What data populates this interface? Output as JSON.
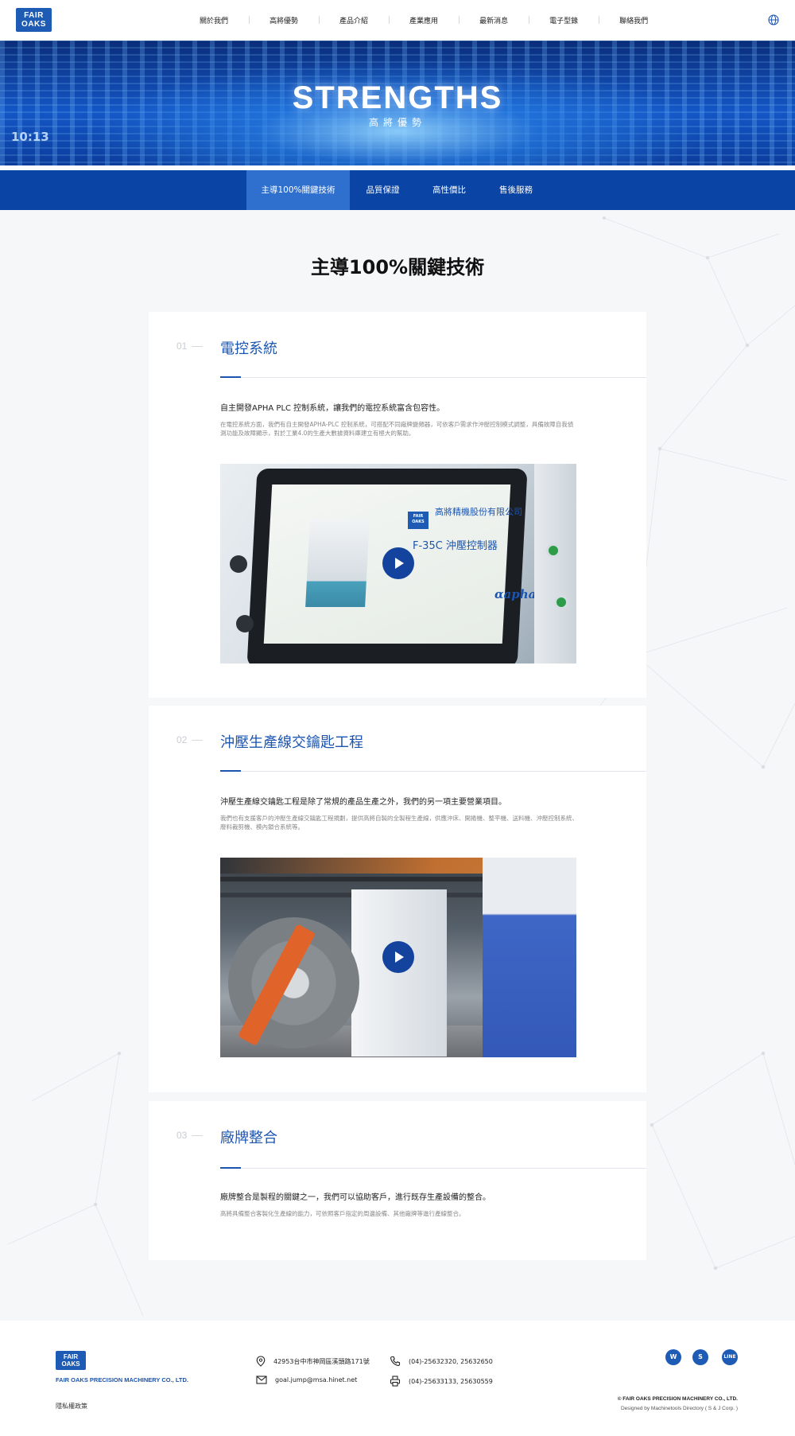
{
  "header": {
    "logo_line1": "FAIR",
    "logo_line2": "OAKS",
    "nav": [
      "關於我們",
      "高將優勢",
      "產品介紹",
      "產業應用",
      "最新消息",
      "電子型錄",
      "聯絡我們"
    ],
    "language_icon": "globe-icon"
  },
  "banner": {
    "title": "STRENGTHS",
    "subtitle": "高將優勢",
    "mark": "10:13"
  },
  "subnav": {
    "items": [
      "主導100%關鍵技術",
      "品質保證",
      "高性價比",
      "售後服務"
    ],
    "active_index": 0
  },
  "main": {
    "section_title": "主導100%關鍵技術",
    "cards": [
      {
        "number": "01",
        "title": "電控系統",
        "lead": "自主開發APHA PLC 控制系統，讓我們的電控系統富含包容性。",
        "description": "在電控系統方面，我們有自主開發APHA-PLC 控制系統，可搭配不同廠牌變頻器，可依客戶需求作沖壓控制模式調整，具備故障自我偵測功能及故障顯示，對於工業4.0的生產大數據資料庫建立有極大的幫助。",
        "video": {
          "screen_company": "高將精機股份有限公司",
          "screen_product": "F-35C 沖壓控制器",
          "screen_brand": "αapha",
          "play_icon": "play-icon"
        }
      },
      {
        "number": "02",
        "title": "沖壓生產線交鑰匙工程",
        "lead": "沖壓生產線交鑰匙工程是除了常規的產品生產之外，我們的另一項主要營業項目。",
        "description": "我們也有支援客戶的沖壓生產線交鑰匙工程規劃，提供高將自製的全製程生產線，供應沖床、開捲機、整平機、送料機、沖壓控制系統、廢料裁剪機、模內鎖合系統等。",
        "video": {
          "play_icon": "play-icon"
        }
      },
      {
        "number": "03",
        "title": "廠牌整合",
        "lead": "廠牌整合是製程的關鍵之一，我們可以協助客戶，進行既存生產設備的整合。",
        "description": "高將具備整合客製化生產線的能力，可依照客戶指定的周邊設備、其他廠牌等進行產線整合。"
      }
    ]
  },
  "footer": {
    "logo_line1": "FAIR",
    "logo_line2": "OAKS",
    "company": "FAIR OAKS PRECISION MACHINERY CO., LTD.",
    "privacy": "隱私權政策",
    "address": "42953台中市神岡區溪頭路171號",
    "email": "goal.jump@msa.hinet.net",
    "phone": "(04)-25632320, 25632650",
    "fax": "(04)-25633133, 25630559",
    "social": [
      {
        "name": "wechat",
        "label": "W"
      },
      {
        "name": "skype",
        "label": "S"
      },
      {
        "name": "line",
        "label": "LINE"
      }
    ],
    "copyright": "© FAIR OAKS PRECISION MACHINERY CO., LTD.",
    "designed_by": "Designed by Machinetools Directory ( S & J Corp. )"
  }
}
